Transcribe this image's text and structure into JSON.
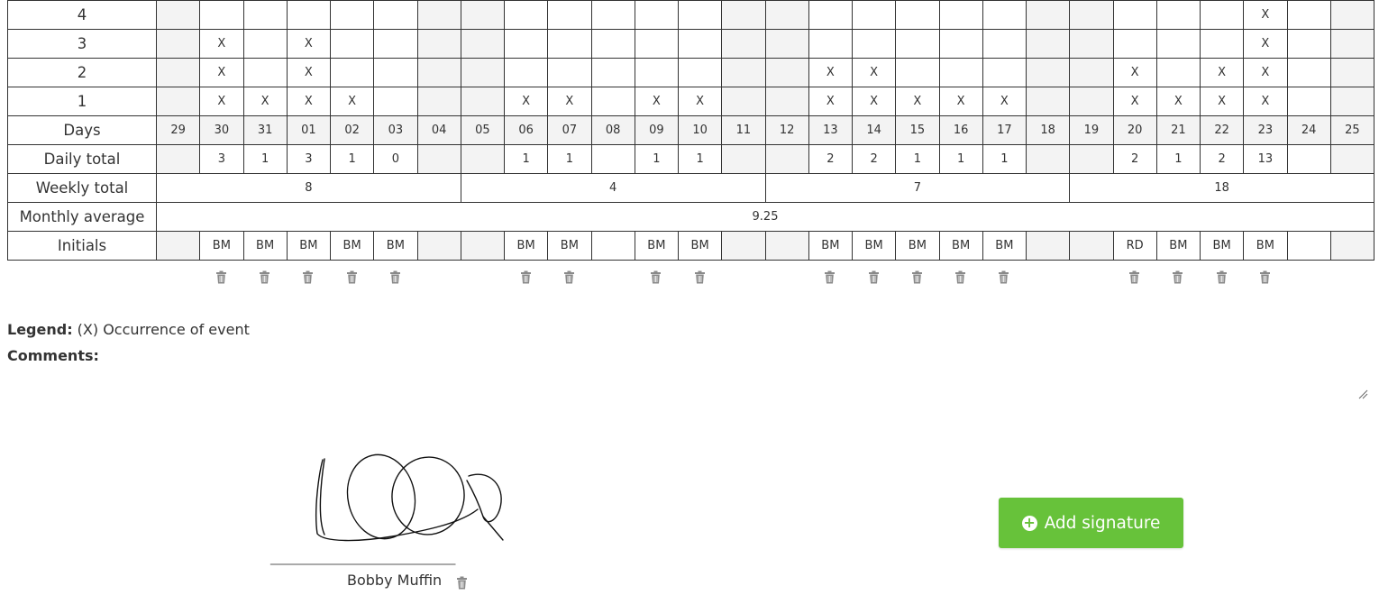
{
  "row_labels": {
    "count_4": "4",
    "count_3": "3",
    "count_2": "2",
    "count_1": "1",
    "days": "Days",
    "daily_total": "Daily total",
    "weekly_total": "Weekly total",
    "monthly_average": "Monthly average",
    "initials": "Initials"
  },
  "days": [
    "29",
    "30",
    "31",
    "01",
    "02",
    "03",
    "04",
    "05",
    "06",
    "07",
    "08",
    "09",
    "10",
    "11",
    "12",
    "13",
    "14",
    "15",
    "16",
    "17",
    "18",
    "19",
    "20",
    "21",
    "22",
    "23",
    "24",
    "25"
  ],
  "marks": {
    "count_4": [
      "",
      "",
      "",
      "",
      "",
      "",
      "",
      "",
      "",
      "",
      "",
      "",
      "",
      "",
      "",
      "",
      "",
      "",
      "",
      "",
      "",
      "",
      "",
      "",
      "",
      "X",
      "",
      ""
    ],
    "count_3": [
      "",
      "X",
      "",
      "X",
      "",
      "",
      "",
      "",
      "",
      "",
      "",
      "",
      "",
      "",
      "",
      "",
      "",
      "",
      "",
      "",
      "",
      "",
      "",
      "",
      "",
      "X",
      "",
      ""
    ],
    "count_2": [
      "",
      "X",
      "",
      "X",
      "",
      "",
      "",
      "",
      "",
      "",
      "",
      "",
      "",
      "",
      "",
      "X",
      "X",
      "",
      "",
      "",
      "",
      "",
      "X",
      "",
      "X",
      "X",
      "",
      ""
    ],
    "count_1": [
      "",
      "X",
      "X",
      "X",
      "X",
      "",
      "",
      "",
      "X",
      "X",
      "",
      "X",
      "X",
      "",
      "",
      "X",
      "X",
      "X",
      "X",
      "X",
      "",
      "",
      "X",
      "X",
      "X",
      "X",
      "",
      ""
    ]
  },
  "daily_totals": [
    "",
    "3",
    "1",
    "3",
    "1",
    "0",
    "",
    "",
    "1",
    "1",
    "",
    "1",
    "1",
    "",
    "",
    "2",
    "2",
    "1",
    "1",
    "1",
    "",
    "",
    "2",
    "1",
    "2",
    "13",
    "",
    ""
  ],
  "weekly_totals": [
    "8",
    "4",
    "7",
    "18"
  ],
  "monthly_average": "9.25",
  "initials": [
    "",
    "BM",
    "BM",
    "BM",
    "BM",
    "BM",
    "",
    "",
    "BM",
    "BM",
    "",
    "BM",
    "BM",
    "",
    "",
    "BM",
    "BM",
    "BM",
    "BM",
    "BM",
    "",
    "",
    "RD",
    "BM",
    "BM",
    "BM",
    "",
    ""
  ],
  "legend": {
    "label": "Legend:",
    "text": " (X) Occurrence of event"
  },
  "comments": {
    "label": "Comments:"
  },
  "signature": {
    "name": "Bobby Muffin",
    "line": "________________________________"
  },
  "add_signature": {
    "label": "Add signature",
    "accent": "#67c23a"
  },
  "icons": {
    "delete": "trash-icon",
    "add": "plus-circle-icon",
    "resize": "resize-grip-icon"
  }
}
